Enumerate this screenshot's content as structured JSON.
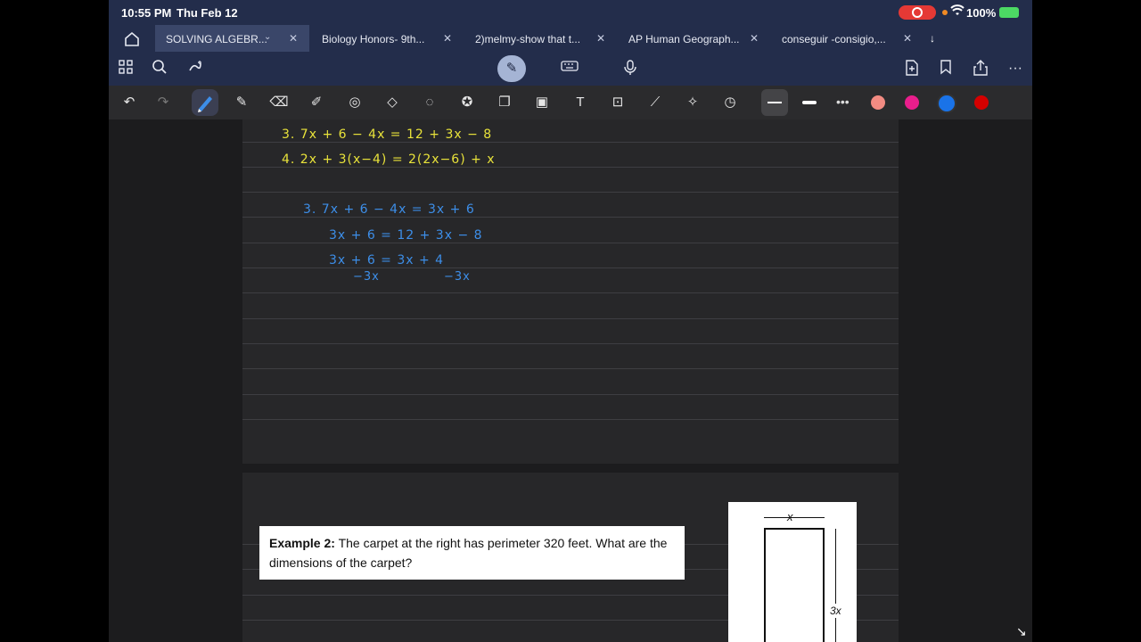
{
  "status": {
    "time": "10:55 PM",
    "date": "Thu Feb 12",
    "battery": "100%"
  },
  "tabs": [
    {
      "label": "SOLVING ALGEBR...",
      "active": true
    },
    {
      "label": "Biology Honors- 9th..."
    },
    {
      "label": "2)melmy-show that t..."
    },
    {
      "label": "AP Human Geograph..."
    },
    {
      "label": "conseguir -consigio,..."
    }
  ],
  "tabs_more": "↓",
  "icons": {
    "home": "home-icon",
    "grid": "grid-icon",
    "search": "search-icon",
    "share": "share-icon",
    "bookmark": "bookmark-icon",
    "add_page": "add-page-icon",
    "more": "more-icon",
    "keyboard": "keyboard-icon",
    "mic": "microphone-icon",
    "pen_mode": "pen-mode-icon"
  },
  "colors": {
    "pink": "#f28b82",
    "magenta": "#e91e8c",
    "blue": "#1a73e8",
    "red": "#d50000",
    "ink_yellow": "#e8e23a",
    "ink_blue": "#3d8ee8"
  },
  "notes": {
    "problem3": "3.  7x + 6  − 4x  =  12 + 3x − 8",
    "problem4": "4.  2x  +  3(x−4)  =  2(2x−6)  + x",
    "step1": "3.  7x + 6 − 4x   =  3x + 6",
    "step2": "3x + 6  =  12 + 3x − 8",
    "step3": "3x + 6  =  3x  +  4",
    "step4a": "−3x",
    "step4b": "−3x"
  },
  "example": {
    "label": "Example 2:",
    "text": "The carpet at the right has perimeter 320 feet. What are the dimensions of the carpet?"
  },
  "figure": {
    "x_label": "x",
    "y_label": "3x"
  }
}
